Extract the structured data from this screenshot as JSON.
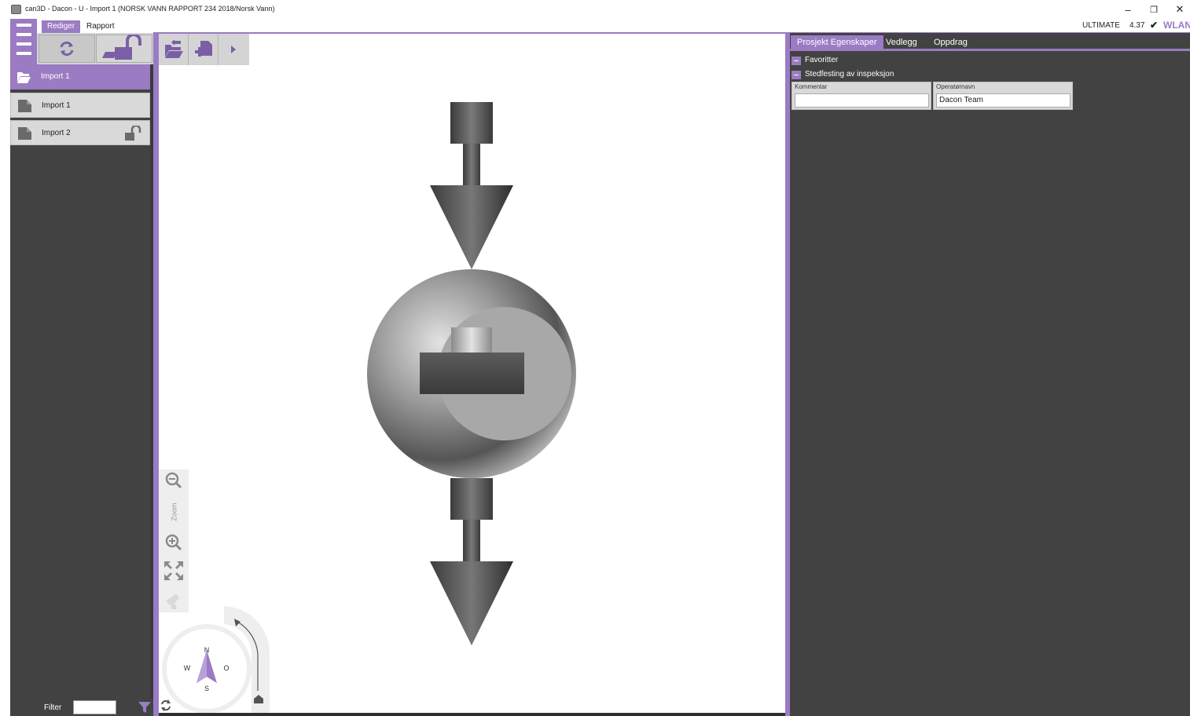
{
  "window": {
    "title": "can3D - Dacon - U - Import 1 (NORSK VANN RAPPORT 234 2018/Norsk Vann)",
    "minimize_glyph": "–",
    "restore_glyph": "❐",
    "close_glyph": "✕"
  },
  "menu": {
    "tabs": [
      {
        "label": "Rediger",
        "active": true
      },
      {
        "label": "Rapport",
        "active": false
      }
    ]
  },
  "status": {
    "edition": "ULTIMATE",
    "version": "4.37",
    "connection_mark": "✔",
    "connection_label": "WLAN"
  },
  "tree": {
    "items": [
      {
        "label": "Import 1",
        "icon": "folder-open-icon",
        "selected": true,
        "locked": false
      },
      {
        "label": "Import 1",
        "icon": "file-icon",
        "selected": false,
        "locked": false
      },
      {
        "label": "Import 2",
        "icon": "file-icon",
        "selected": false,
        "locked": true
      }
    ]
  },
  "filter": {
    "label": "Filter",
    "value": ""
  },
  "viewport": {
    "zoom_label": "Zoom",
    "compass": {
      "n": "N",
      "s": "S",
      "w": "W",
      "e": "O"
    }
  },
  "right_panel": {
    "tabs": [
      {
        "label": "Prosjekt Egenskaper",
        "active": true
      },
      {
        "label": "Vedlegg",
        "active": false
      },
      {
        "label": "Oppdrag",
        "active": false
      }
    ],
    "sections": [
      {
        "label": "Favoritter"
      },
      {
        "label": "Stedfesting av inspeksjon"
      }
    ],
    "fields": [
      {
        "label": "Kommentar",
        "value": ""
      },
      {
        "label": "Operatørnavn",
        "value": "Dacon Team"
      }
    ]
  },
  "colors": {
    "accent": "#9b7bc3",
    "panel_dark": "#424242",
    "toolbar_gray": "#d4d4d4"
  }
}
